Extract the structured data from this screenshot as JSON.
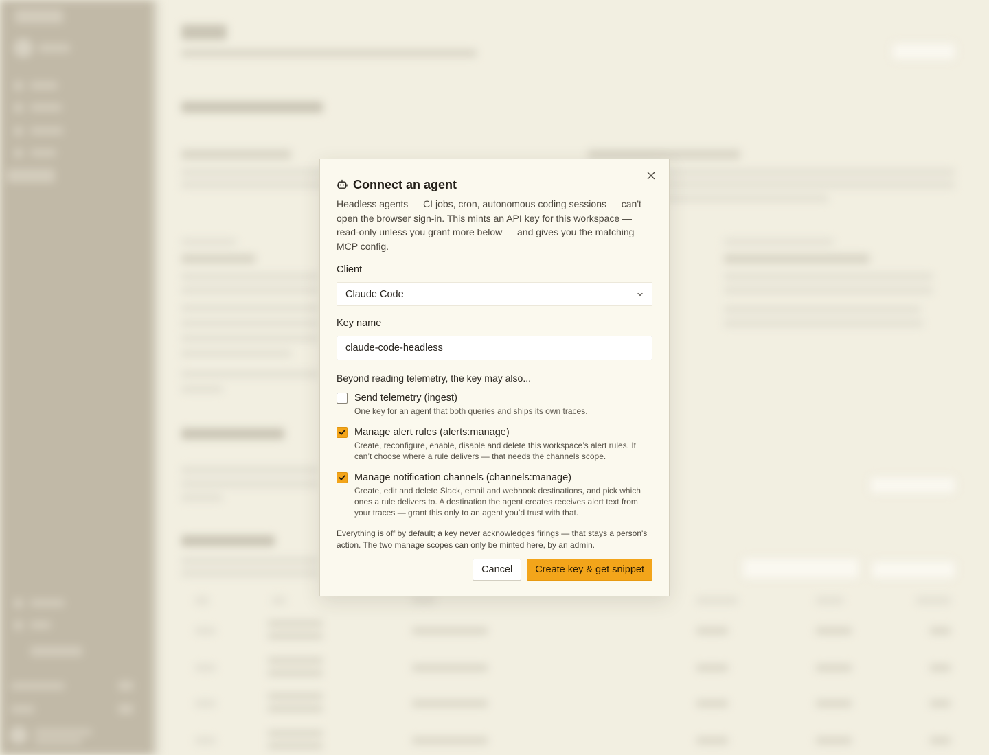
{
  "modal": {
    "title": "Connect an agent",
    "description": "Headless agents — CI jobs, cron, autonomous coding sessions — can't open the browser sign-in. This mints an API key for this workspace — read-only unless you grant more below — and gives you the matching MCP config.",
    "client_label": "Client",
    "client_value": "Claude Code",
    "key_name_label": "Key name",
    "key_name_value": "claude-code-headless",
    "scopes_intro": "Beyond reading telemetry, the key may also...",
    "scopes": [
      {
        "title": "Send telemetry (ingest)",
        "description": "One key for an agent that both queries and ships its own traces.",
        "checked": false
      },
      {
        "title": "Manage alert rules (alerts:manage)",
        "description": "Create, reconfigure, enable, disable and delete this workspace’s alert rules. It can’t choose where a rule delivers — that needs the channels scope.",
        "checked": true
      },
      {
        "title": "Manage notification channels (channels:manage)",
        "description": "Create, edit and delete Slack, email and webhook destinations, and pick which ones a rule delivers to. A destination the agent creates receives alert text from your traces — grant this only to an agent you’d trust with that.",
        "checked": true
      }
    ],
    "footer_note": "Everything is off by default; a key never acknowledges firings — that stays a person's action. The two manage scopes can only be minted here, by an admin.",
    "cancel_label": "Cancel",
    "create_label": "Create key & get snippet"
  },
  "colors": {
    "accent": "#f3a51a",
    "backdrop": "#f2efe1",
    "sidebar": "#c1b9a7",
    "modal_bg": "#fbf9ee"
  },
  "icons": {
    "title": "robot-icon",
    "close": "close-icon",
    "select": "chevron-down-icon",
    "checkbox": "check-icon"
  }
}
